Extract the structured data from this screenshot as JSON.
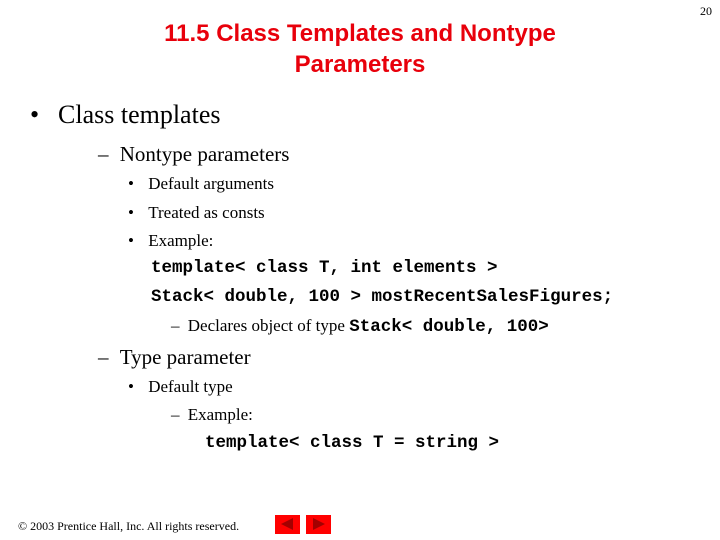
{
  "slide": {
    "page_number": "20",
    "title_line1": "11.5  Class Templates and Nontype",
    "title_line2": "Parameters",
    "bullet_glyph": "•",
    "dash_glyph": "–",
    "bullets": {
      "class_templates": "Class templates",
      "nontype_parameters": "Nontype parameters",
      "default_arguments": "Default arguments",
      "treated_as_consts": "Treated as consts",
      "example": "Example:",
      "code_template": "template< class T, int elements >",
      "code_stack": "Stack< double, 100 > mostRecentSalesFigures;",
      "declares_text": "Declares object of type ",
      "declares_code": "Stack< double, 100>",
      "type_parameter": "Type parameter",
      "default_type": "Default type",
      "example2": "Example:",
      "code_default": "template< class T = string >"
    },
    "footer": {
      "copyright": "© 2003 Prentice Hall, Inc.  All rights reserved."
    },
    "nav": {
      "prev_icon": "previous-slide-icon",
      "next_icon": "next-slide-icon",
      "color": "#ff0000",
      "arrow_color": "#a40000"
    },
    "colors": {
      "title": "#e8000b"
    }
  }
}
